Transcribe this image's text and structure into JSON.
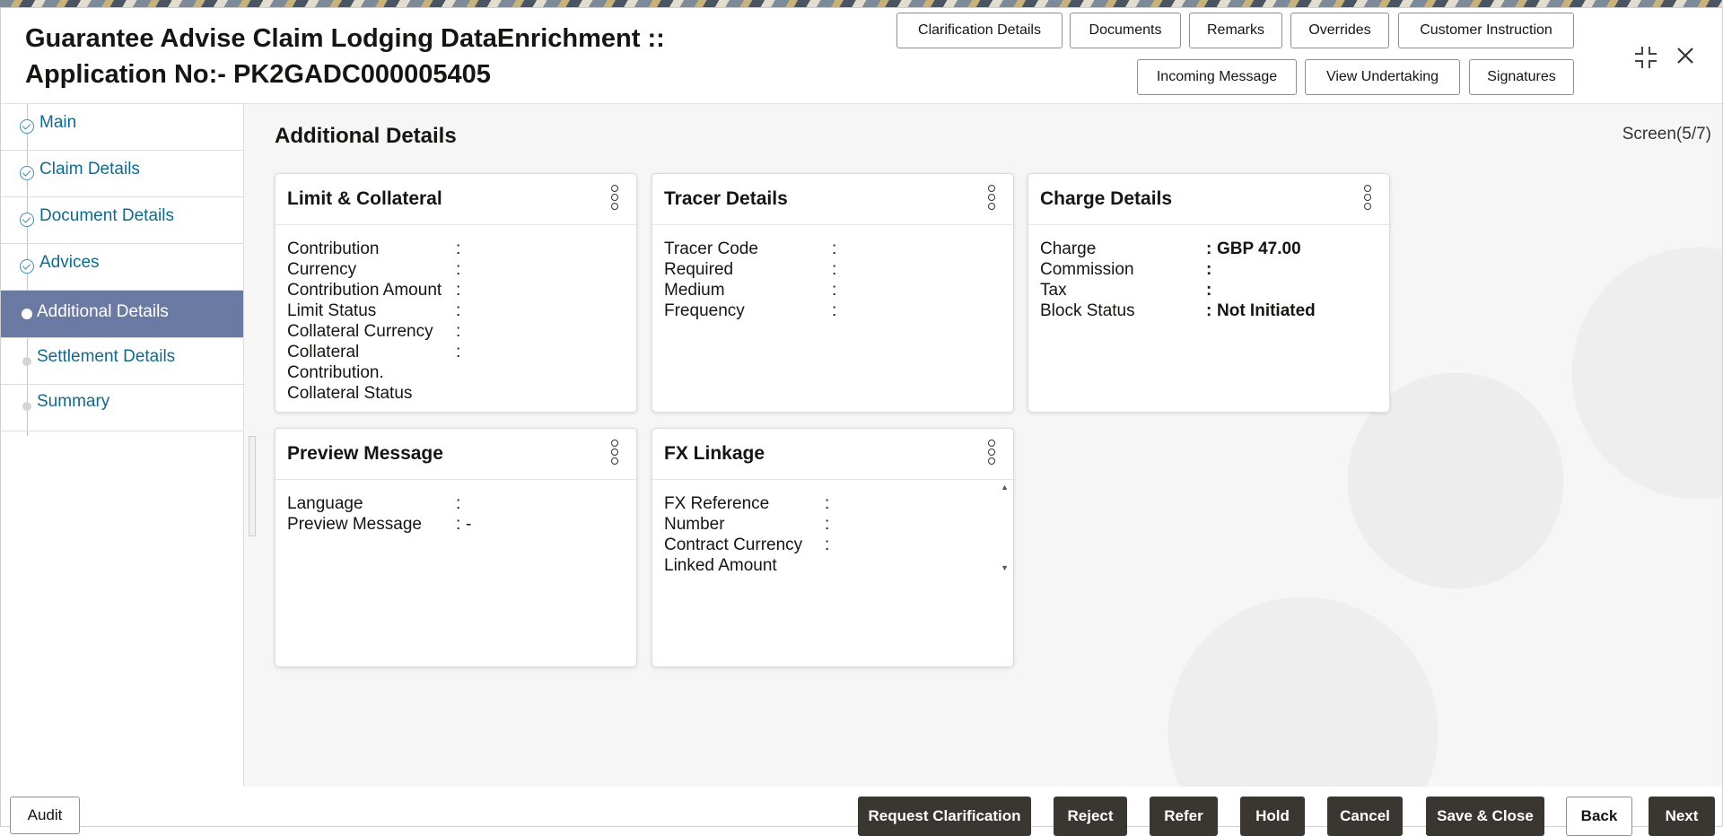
{
  "header": {
    "title_line1": "Guarantee Advise Claim Lodging DataEnrichment ::",
    "title_line2": "Application No:- PK2GADC000005405",
    "buttons": [
      "Clarification Details",
      "Documents",
      "Remarks",
      "Overrides",
      "Customer Instruction",
      "Incoming Message",
      "View Undertaking",
      "Signatures"
    ],
    "window_icons": [
      "collapse-icon",
      "close-icon"
    ]
  },
  "sidebar": {
    "items": [
      {
        "label": "Main",
        "state": "done"
      },
      {
        "label": "Claim Details",
        "state": "done"
      },
      {
        "label": "Document Details",
        "state": "done"
      },
      {
        "label": "Advices",
        "state": "done"
      },
      {
        "label": "Additional Details",
        "state": "current"
      },
      {
        "label": "Settlement Details",
        "state": "pending"
      },
      {
        "label": "Summary",
        "state": "pending"
      }
    ]
  },
  "main": {
    "section_title": "Additional Details",
    "screen_indicator": "Screen(5/7)",
    "cards": {
      "limit": {
        "title": "Limit & Collateral",
        "fields": [
          "Contribution",
          "Currency",
          "Contribution Amount",
          "Limit Status",
          "Collateral Currency",
          "Collateral",
          "Contribution.",
          "Collateral Status"
        ]
      },
      "tracer": {
        "title": "Tracer Details",
        "fields": [
          "Tracer Code",
          "Required",
          "Medium",
          "Frequency"
        ]
      },
      "charge": {
        "title": "Charge Details",
        "fields": [
          "Charge",
          "Commission",
          "Tax",
          "Block Status"
        ],
        "values": {
          "charge": "GBP  47.00",
          "block_status": "Not Initiated"
        }
      },
      "preview": {
        "title": "Preview Message",
        "fields": [
          "Language",
          "Preview Message"
        ],
        "values": {
          "preview_message": "-"
        }
      },
      "fx": {
        "title": "FX Linkage",
        "fields": [
          "FX Reference",
          "Number",
          "Contract Currency",
          "Linked Amount"
        ]
      }
    },
    "colon": ":"
  },
  "footer": {
    "audit": "Audit",
    "buttons": [
      "Request Clarification",
      "Reject",
      "Refer",
      "Hold",
      "Cancel",
      "Save & Close",
      "Back",
      "Next"
    ]
  }
}
